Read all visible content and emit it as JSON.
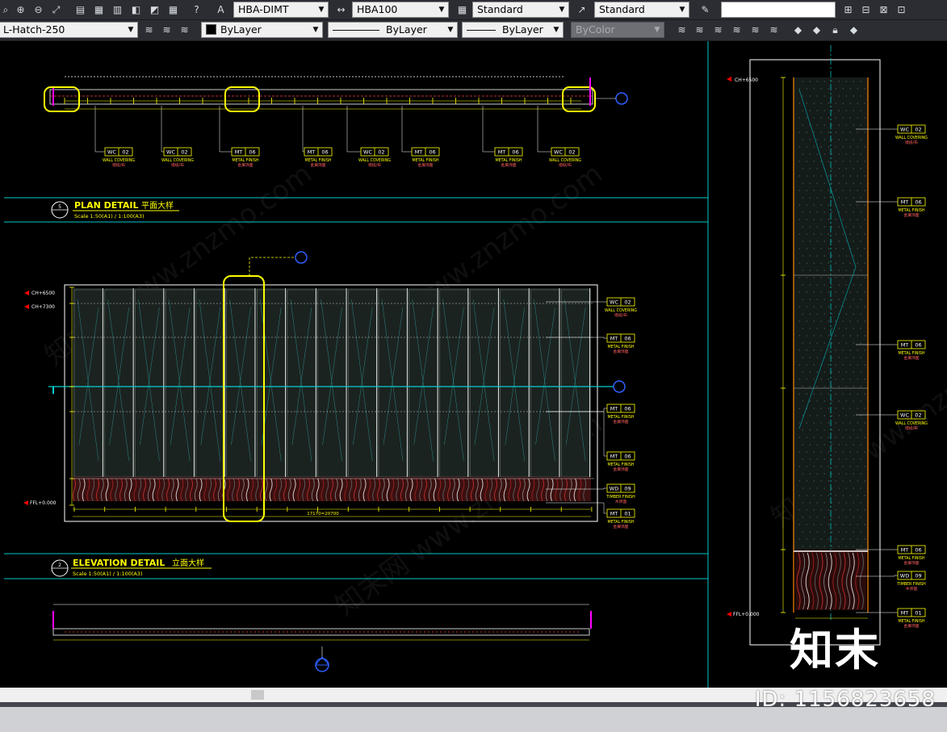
{
  "toolbar_row1": {
    "dimstyle": "HBA-DIMT",
    "scale": "HBA100",
    "tablestyle": "Standard",
    "mleaderstyle": "Standard",
    "search_value": ""
  },
  "toolbar_row2": {
    "layer": "L-Hatch-250",
    "color": "ByLayer",
    "linetype": "ByLayer",
    "lineweight": "ByLayer",
    "plotstyle": "ByColor"
  },
  "drawing": {
    "plan_title_num": "5",
    "plan_title": "PLAN DETAIL",
    "plan_title_cn": "平面大样",
    "plan_scale": "Scale 1:50(A1) / 1:100(A3)",
    "elev_title_num": "2",
    "elev_title": "ELEVATION  DETAIL",
    "elev_title_cn": "立面大样",
    "elev_scale": "Scale 1:50(A1) / 1:100(A3)",
    "level_ch6500": "CH+6500",
    "level_ch7300": "CH+7300",
    "level_ffl": "FFL+0.000",
    "level_side_ch": "CH+6500",
    "level_side_ffl": "FFL+0.000",
    "plan_tags": [
      {
        "code": "WC",
        "num": "02",
        "label": "WALL COVERING",
        "cn": "墙纸/布"
      },
      {
        "code": "WC",
        "num": "02",
        "label": "WALL COVERING",
        "cn": "墙纸/布"
      },
      {
        "code": "MT",
        "num": "06",
        "label": "METAL FINISH",
        "cn": "金属饰面"
      },
      {
        "code": "MT",
        "num": "06",
        "label": "METAL FINISH",
        "cn": "金属饰面"
      },
      {
        "code": "WC",
        "num": "02",
        "label": "WALL COVERING",
        "cn": "墙纸/布"
      },
      {
        "code": "MT",
        "num": "06",
        "label": "METAL FINISH",
        "cn": "金属饰面"
      },
      {
        "code": "MT",
        "num": "06",
        "label": "METAL FINISH",
        "cn": "金属饰面"
      },
      {
        "code": "WC",
        "num": "02",
        "label": "WALL COVERING",
        "cn": "墙纸/布"
      }
    ],
    "elev_tags": [
      {
        "code": "WC",
        "num": "02",
        "label": "WALL COVERING",
        "cn": "墙纸/布"
      },
      {
        "code": "MT",
        "num": "06",
        "label": "METAL FINISH",
        "cn": "金属饰面"
      },
      {
        "code": "MT",
        "num": "06",
        "label": "METAL FINISH",
        "cn": "金属饰面"
      },
      {
        "code": "MT",
        "num": "06",
        "label": "METAL FINISH",
        "cn": "金属饰面"
      },
      {
        "code": "WD",
        "num": "09",
        "label": "TIMBER FINISH",
        "cn": "木饰面"
      },
      {
        "code": "MT",
        "num": "01",
        "label": "METAL FINISH",
        "cn": "金属饰面"
      }
    ],
    "side_tags": [
      {
        "code": "WC",
        "num": "02",
        "label": "WALL COVERING",
        "cn": "墙纸/布"
      },
      {
        "code": "MT",
        "num": "06",
        "label": "METAL FINISH",
        "cn": "金属饰面"
      },
      {
        "code": "MT",
        "num": "06",
        "label": "METAL FINISH",
        "cn": "金属饰面"
      },
      {
        "code": "WC",
        "num": "02",
        "label": "WALL COVERING",
        "cn": "墙纸/布"
      },
      {
        "code": "MT",
        "num": "06",
        "label": "METAL FINISH",
        "cn": "金属饰面"
      },
      {
        "code": "WD",
        "num": "09",
        "label": "TIMBER FINISH",
        "cn": "木饰面"
      },
      {
        "code": "MT",
        "num": "01",
        "label": "METAL FINISH",
        "cn": "金属饰面"
      }
    ],
    "dim_total": "17170=20700"
  },
  "watermark": {
    "id_text": "ID: 1156823658",
    "logo_text": "知末"
  },
  "colors": {
    "canvas": "#000000",
    "cyan": "#00c8c8",
    "yellow": "#ffff00",
    "white": "#ffffff",
    "red": "#ff0000",
    "blue": "#2f5fff"
  }
}
